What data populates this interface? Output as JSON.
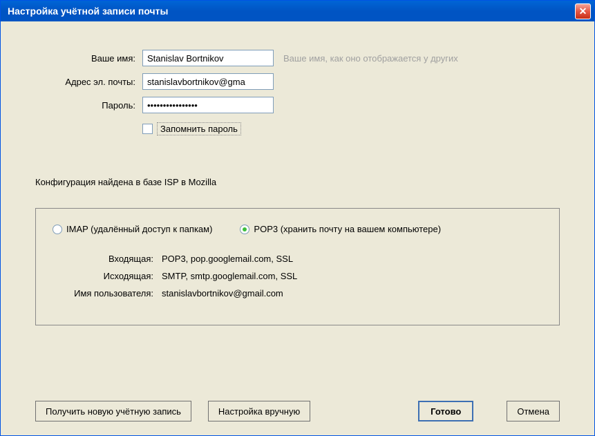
{
  "window": {
    "title": "Настройка учётной записи почты"
  },
  "form": {
    "name_label": "Ваше имя:",
    "name_value": "Stanislav Bortnikov",
    "name_hint": "Ваше имя, как оно отображается у других",
    "email_label": "Адрес эл. почты:",
    "email_value": "stanislavbortnikov@gma",
    "password_label": "Пароль:",
    "password_value": "••••••••••••••••",
    "remember_label": "Запомнить пароль"
  },
  "status": "Конфигурация найдена в базе ISP в Mozilla",
  "config": {
    "imap_label": "IMAP (удалённый доступ к папкам)",
    "pop3_label": "POP3 (хранить почту на вашем компьютере)",
    "incoming_label": "Входящая:",
    "incoming_value": "POP3, pop.googlemail.com, SSL",
    "outgoing_label": "Исходящая:",
    "outgoing_value": "SMTP, smtp.googlemail.com, SSL",
    "username_label": "Имя пользователя:",
    "username_value": "stanislavbortnikov@gmail.com"
  },
  "buttons": {
    "get_new": "Получить новую учётную запись",
    "manual": "Настройка вручную",
    "done": "Готово",
    "cancel": "Отмена"
  }
}
